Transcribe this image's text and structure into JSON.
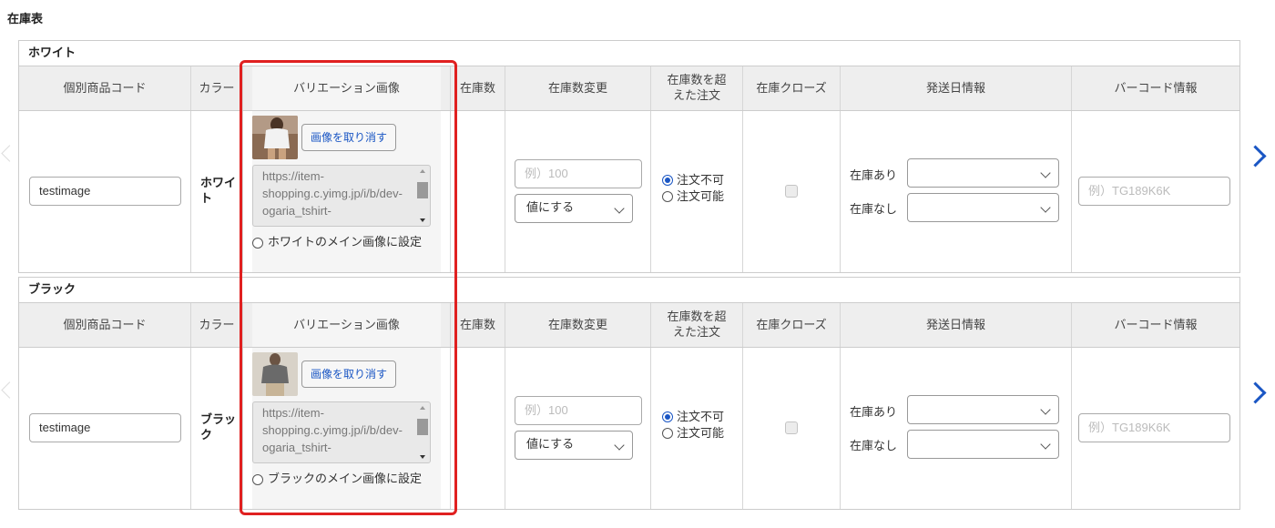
{
  "page_title": "在庫表",
  "headers": {
    "code": "個別商品コード",
    "color": "カラー",
    "variation_image": "バリエーション画像",
    "stock": "在庫数",
    "stock_change": "在庫数変更",
    "over_order": "在庫数を超えた注文",
    "stock_close": "在庫クローズ",
    "ship_info": "発送日情報",
    "barcode": "バーコード情報"
  },
  "sections": [
    {
      "name": "ホワイト",
      "code_value": "testimage",
      "color_label": "ホワイト",
      "cancel_image_label": "画像を取り消す",
      "image_url": "https://item-shopping.c.yimg.jp/i/b/dev-ogaria_tshirt-",
      "main_image_label": "ホワイトのメイン画像に設定",
      "stock_change_placeholder": "例）100",
      "stock_change_mode": "値にする",
      "order_options": [
        "注文不可",
        "注文可能"
      ],
      "order_selected": "注文不可",
      "stock_close_checked": false,
      "ship_in_stock_label": "在庫あり",
      "ship_in_stock_value": "",
      "ship_out_stock_label": "在庫なし",
      "ship_out_stock_value": "",
      "barcode_placeholder": "例）TG189K6K"
    },
    {
      "name": "ブラック",
      "code_value": "testimage",
      "color_label": "ブラック",
      "cancel_image_label": "画像を取り消す",
      "image_url": "https://item-shopping.c.yimg.jp/i/b/dev-ogaria_tshirt-",
      "main_image_label": "ブラックのメイン画像に設定",
      "stock_change_placeholder": "例）100",
      "stock_change_mode": "値にする",
      "order_options": [
        "注文不可",
        "注文可能"
      ],
      "order_selected": "注文不可",
      "stock_close_checked": false,
      "ship_in_stock_label": "在庫あり",
      "ship_in_stock_value": "",
      "ship_out_stock_label": "在庫なし",
      "ship_out_stock_value": "",
      "barcode_placeholder": "例）TG189K6K"
    }
  ],
  "colors": {
    "accent": "#1a56c4",
    "highlight": "#e02020",
    "header_bg": "#eeeeee"
  },
  "icons": [
    "chevron-left-icon",
    "chevron-right-icon",
    "chevron-down-icon",
    "radio-icon",
    "checkbox-icon"
  ]
}
